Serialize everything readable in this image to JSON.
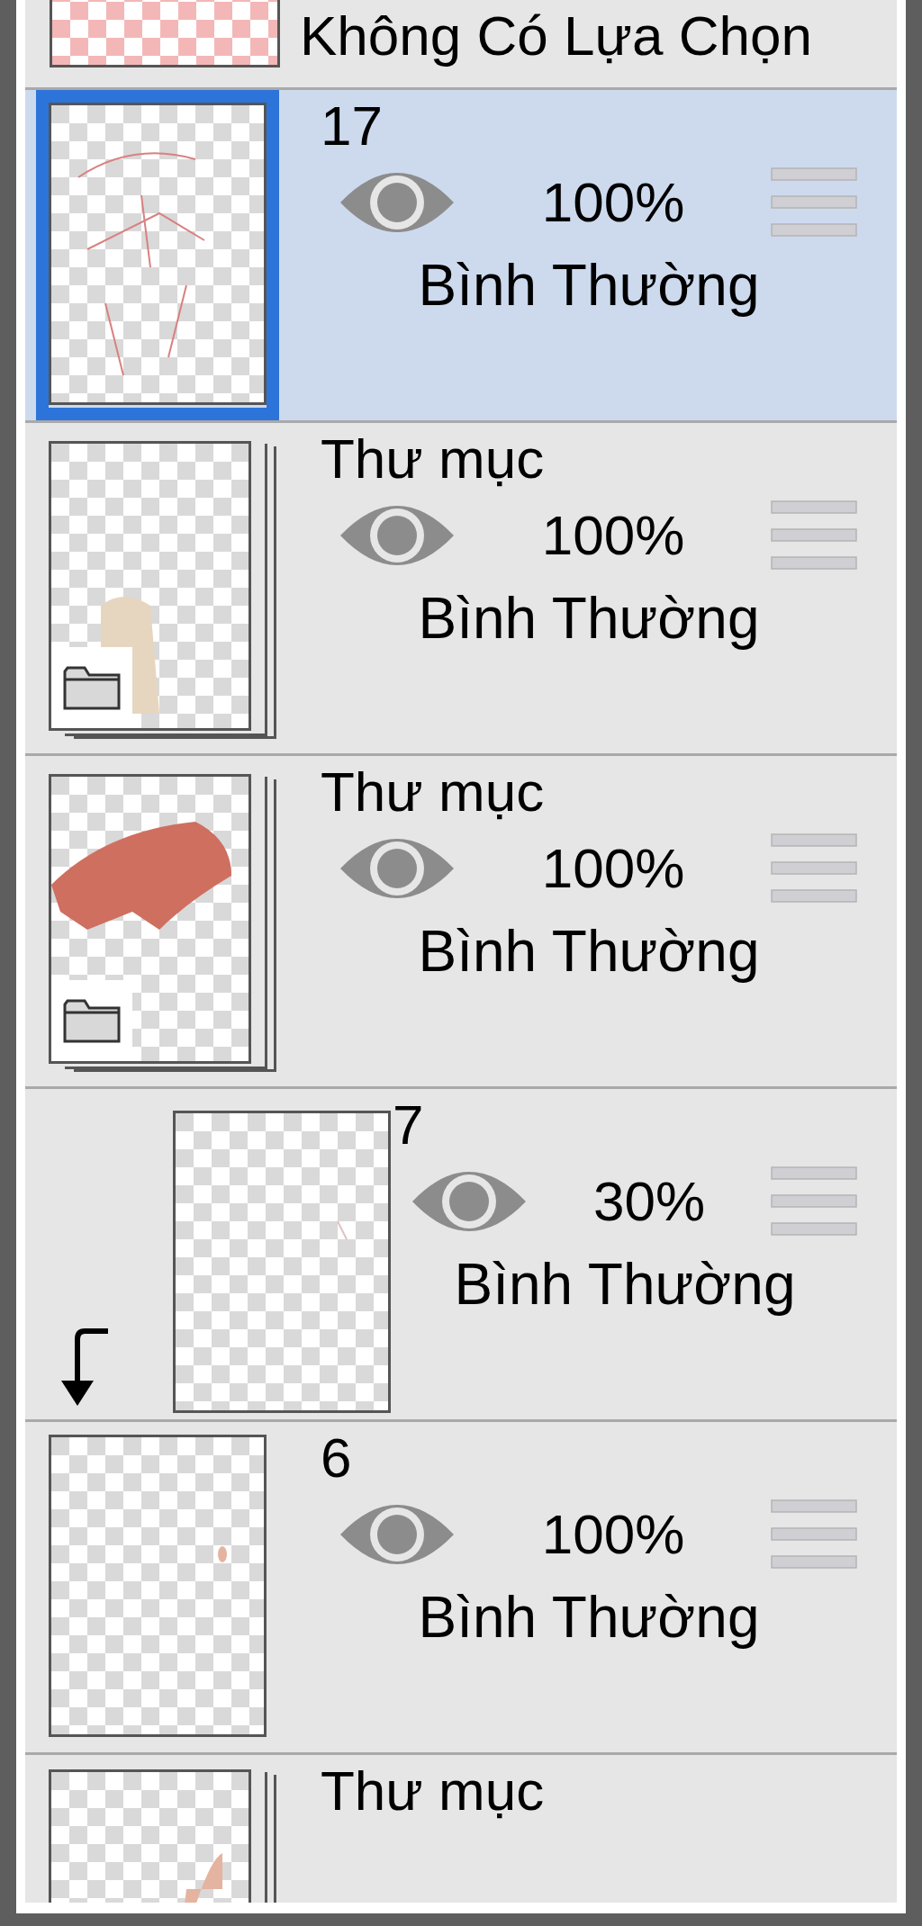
{
  "top_row": {
    "label": "Không Có Lựa Chọn"
  },
  "layers": [
    {
      "name": "17",
      "kind": "layer",
      "selected": true,
      "clipped": false,
      "opacity": "100%",
      "blend": "Bình Thường"
    },
    {
      "name": "Thư mục",
      "kind": "folder",
      "selected": false,
      "clipped": false,
      "opacity": "100%",
      "blend": "Bình Thường"
    },
    {
      "name": "Thư mục",
      "kind": "folder",
      "selected": false,
      "clipped": false,
      "opacity": "100%",
      "blend": "Bình Thường"
    },
    {
      "name": "7",
      "kind": "layer",
      "selected": false,
      "clipped": true,
      "opacity": "30%",
      "blend": "Bình Thường"
    },
    {
      "name": "6",
      "kind": "layer",
      "selected": false,
      "clipped": false,
      "opacity": "100%",
      "blend": "Bình Thường"
    }
  ],
  "bottom_row": {
    "name": "Thư mục",
    "kind": "folder"
  }
}
